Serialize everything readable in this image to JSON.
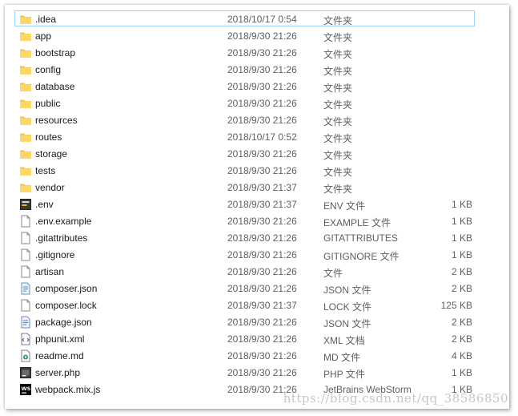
{
  "rows": [
    {
      "name": ".idea",
      "date": "2018/10/17 0:54",
      "type": "文件夹",
      "size": "",
      "icon": "folder-icon",
      "selected": true
    },
    {
      "name": "app",
      "date": "2018/9/30 21:26",
      "type": "文件夹",
      "size": "",
      "icon": "folder-icon"
    },
    {
      "name": "bootstrap",
      "date": "2018/9/30 21:26",
      "type": "文件夹",
      "size": "",
      "icon": "folder-icon"
    },
    {
      "name": "config",
      "date": "2018/9/30 21:26",
      "type": "文件夹",
      "size": "",
      "icon": "folder-icon"
    },
    {
      "name": "database",
      "date": "2018/9/30 21:26",
      "type": "文件夹",
      "size": "",
      "icon": "folder-icon"
    },
    {
      "name": "public",
      "date": "2018/9/30 21:26",
      "type": "文件夹",
      "size": "",
      "icon": "folder-icon"
    },
    {
      "name": "resources",
      "date": "2018/9/30 21:26",
      "type": "文件夹",
      "size": "",
      "icon": "folder-icon"
    },
    {
      "name": "routes",
      "date": "2018/10/17 0:52",
      "type": "文件夹",
      "size": "",
      "icon": "folder-icon"
    },
    {
      "name": "storage",
      "date": "2018/9/30 21:26",
      "type": "文件夹",
      "size": "",
      "icon": "folder-icon"
    },
    {
      "name": "tests",
      "date": "2018/9/30 21:26",
      "type": "文件夹",
      "size": "",
      "icon": "folder-icon"
    },
    {
      "name": "vendor",
      "date": "2018/9/30 21:37",
      "type": "文件夹",
      "size": "",
      "icon": "folder-icon"
    },
    {
      "name": ".env",
      "date": "2018/9/30 21:37",
      "type": "ENV 文件",
      "size": "1 KB",
      "icon": "env-file-icon"
    },
    {
      "name": ".env.example",
      "date": "2018/9/30 21:26",
      "type": "EXAMPLE 文件",
      "size": "1 KB",
      "icon": "blank-file-icon"
    },
    {
      "name": ".gitattributes",
      "date": "2018/9/30 21:26",
      "type": "GITATTRIBUTES",
      "size": "1 KB",
      "icon": "blank-file-icon"
    },
    {
      "name": ".gitignore",
      "date": "2018/9/30 21:26",
      "type": "GITIGNORE 文件",
      "size": "1 KB",
      "icon": "blank-file-icon"
    },
    {
      "name": "artisan",
      "date": "2018/9/30 21:26",
      "type": "文件",
      "size": "2 KB",
      "icon": "blank-file-icon"
    },
    {
      "name": "composer.json",
      "date": "2018/9/30 21:26",
      "type": "JSON 文件",
      "size": "2 KB",
      "icon": "json-file-icon"
    },
    {
      "name": "composer.lock",
      "date": "2018/9/30 21:37",
      "type": "LOCK 文件",
      "size": "125 KB",
      "icon": "blank-file-icon"
    },
    {
      "name": "package.json",
      "date": "2018/9/30 21:26",
      "type": "JSON 文件",
      "size": "2 KB",
      "icon": "json-file-icon"
    },
    {
      "name": "phpunit.xml",
      "date": "2018/9/30 21:26",
      "type": "XML 文档",
      "size": "2 KB",
      "icon": "xml-file-icon"
    },
    {
      "name": "readme.md",
      "date": "2018/9/30 21:26",
      "type": "MD 文件",
      "size": "4 KB",
      "icon": "markdown-file-icon"
    },
    {
      "name": "server.php",
      "date": "2018/9/30 21:26",
      "type": "PHP 文件",
      "size": "1 KB",
      "icon": "php-file-icon"
    },
    {
      "name": "webpack.mix.js",
      "date": "2018/9/30 21:26",
      "type": "JetBrains WebStorm",
      "size": "1 KB",
      "icon": "webstorm-file-icon"
    }
  ],
  "watermark": "https://blog.csdn.net/qq_38586850",
  "colors": {
    "folder": "#ffd766",
    "selection_border": "#99d1ff",
    "secondary_text": "#5f5f5f"
  }
}
